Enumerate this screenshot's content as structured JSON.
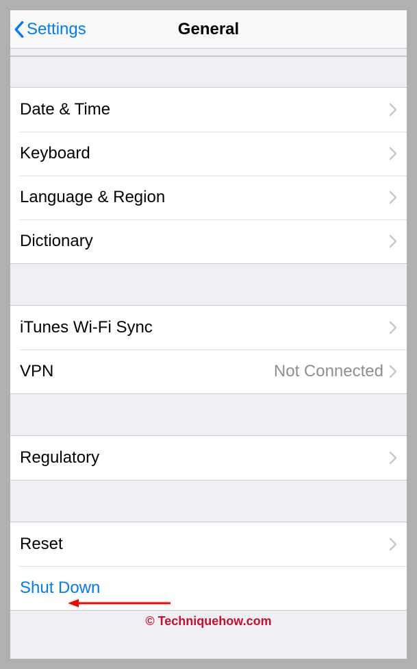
{
  "navbar": {
    "back_label": "Settings",
    "title": "General"
  },
  "groups": [
    {
      "rows": [
        {
          "label": "Date & Time"
        },
        {
          "label": "Keyboard"
        },
        {
          "label": "Language & Region"
        },
        {
          "label": "Dictionary"
        }
      ]
    },
    {
      "rows": [
        {
          "label": "iTunes Wi-Fi Sync"
        },
        {
          "label": "VPN",
          "value": "Not Connected"
        }
      ]
    },
    {
      "rows": [
        {
          "label": "Regulatory"
        }
      ]
    },
    {
      "rows": [
        {
          "label": "Reset"
        },
        {
          "label": "Shut Down",
          "blue": true,
          "no_chevron": true
        }
      ]
    }
  ],
  "watermark": "© Techniquehow.com"
}
